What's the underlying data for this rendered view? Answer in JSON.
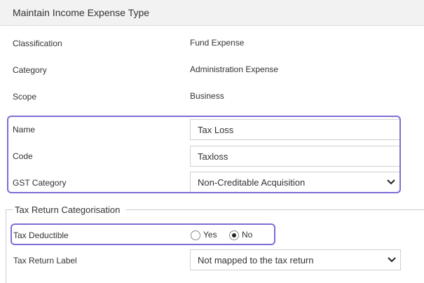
{
  "header": {
    "title": "Maintain Income Expense Type"
  },
  "details": {
    "classification": {
      "label": "Classification",
      "value": "Fund Expense"
    },
    "category": {
      "label": "Category",
      "value": "Administration Expense"
    },
    "scope": {
      "label": "Scope",
      "value": "Business"
    }
  },
  "form": {
    "name": {
      "label": "Name",
      "value": "Tax Loss"
    },
    "code": {
      "label": "Code",
      "value": "Taxloss"
    },
    "gst_category": {
      "label": "GST Category",
      "value": "Non-Creditable Acquisition"
    }
  },
  "tax_return": {
    "legend": "Tax Return Categorisation",
    "tax_deductible": {
      "label": "Tax Deductible",
      "options": [
        "Yes",
        "No"
      ],
      "selected": "No"
    },
    "tax_return_label": {
      "label": "Tax Return Label",
      "value": "Not mapped to the tax return"
    }
  },
  "colors": {
    "highlight": "#7b6fd6",
    "header_bg": "#f2f2f2"
  },
  "icons": {
    "select_caret": "chevron-down-icon"
  }
}
